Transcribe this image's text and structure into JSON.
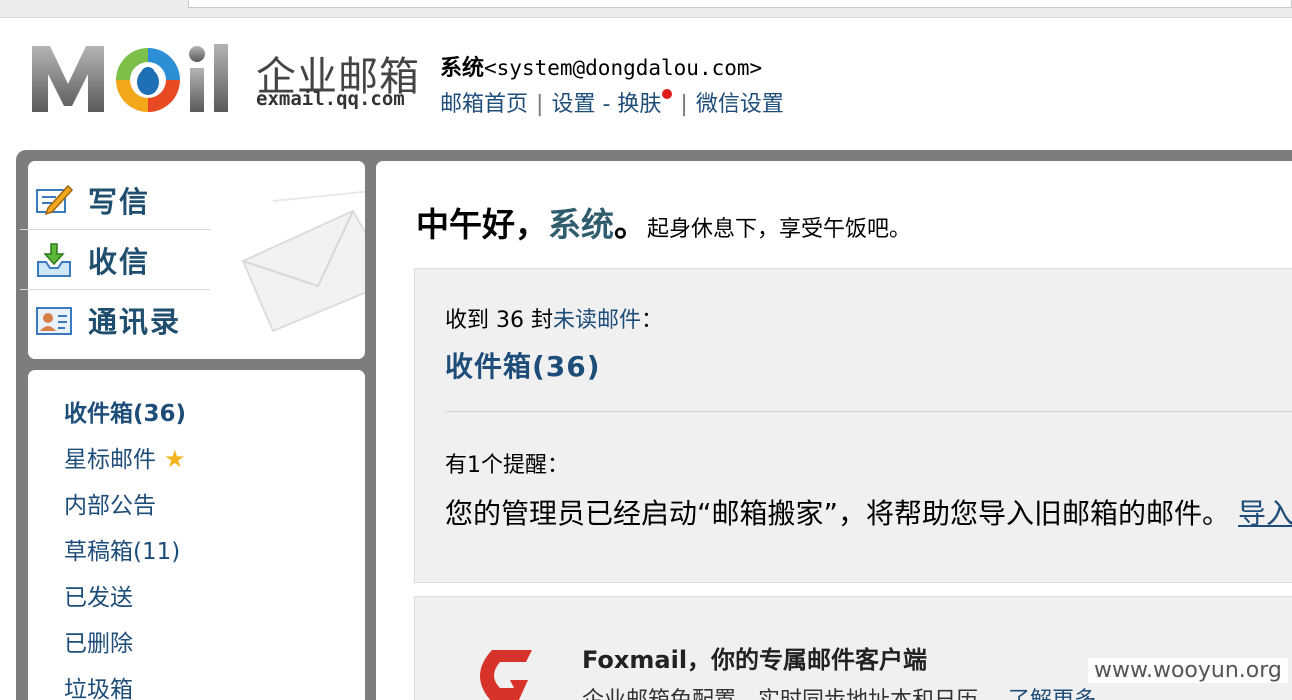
{
  "header": {
    "logo_cn": "企业邮箱",
    "logo_domain": "exmail.qq.com",
    "user_name": "系统",
    "user_email": "<system@dongdalou.com>",
    "links": {
      "home": "邮箱首页",
      "settings": "设置",
      "dash": "-",
      "skin": "换肤",
      "wechat": "微信设置"
    }
  },
  "actions": {
    "compose": "写信",
    "receive": "收信",
    "contacts": "通讯录"
  },
  "folders": [
    {
      "label": "收件箱(36)",
      "bold": true
    },
    {
      "label": "星标邮件",
      "bold": false
    },
    {
      "label": "内部公告",
      "bold": false
    },
    {
      "label": "草稿箱(11)",
      "bold": false
    },
    {
      "label": "已发送",
      "bold": false
    },
    {
      "label": "已删除",
      "bold": false
    },
    {
      "label": "垃圾箱",
      "bold": false
    }
  ],
  "main": {
    "greeting_time": "中午好，",
    "greeting_name": "系统",
    "greeting_period": "。",
    "greeting_tip": "起身休息下，享受午饭吧。",
    "unread_prefix": "收到 ",
    "unread_count": "36",
    "unread_mid": " 封",
    "unread_link": "未读邮件",
    "unread_suffix": "：",
    "inbox_link": "收件箱(36)",
    "reminder_title": "有1个提醒：",
    "notice_text": "您的管理员已经启动“邮箱搬家”，将帮助您导入旧邮箱的邮件。",
    "notice_link": "导入"
  },
  "foxmail": {
    "title": "Foxmail，你的专属邮件客户端",
    "desc": "企业邮箱免配置，实时同步地址本和日历。",
    "link": "了解更多"
  },
  "watermark": "www.wooyun.org",
  "colors": {
    "link": "#1e4d7a",
    "frame": "#7d7d7d",
    "panel_bg": "#f0f0f0",
    "notify_dot": "#e01b1b",
    "star": "#f3b61f"
  }
}
